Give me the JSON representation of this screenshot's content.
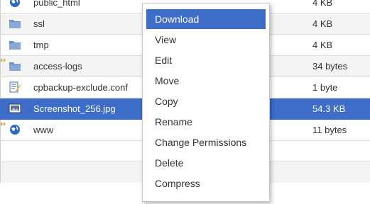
{
  "files": [
    {
      "name": "public_html",
      "size": "4 KB",
      "icon": "globe-folder-icon"
    },
    {
      "name": "ssl",
      "size": "4 KB",
      "icon": "folder-icon"
    },
    {
      "name": "tmp",
      "size": "4 KB",
      "icon": "folder-icon"
    },
    {
      "name": "access-logs",
      "size": "34 bytes",
      "icon": "folder-link-icon"
    },
    {
      "name": "cpbackup-exclude.conf",
      "size": "1 byte",
      "icon": "text-file-icon"
    },
    {
      "name": "Screenshot_256.jpg",
      "size": "54.3 KB",
      "icon": "image-file-icon"
    },
    {
      "name": "www",
      "size": "11 bytes",
      "icon": "globe-link-icon"
    }
  ],
  "context_menu": {
    "items": [
      "Download",
      "View",
      "Edit",
      "Move",
      "Copy",
      "Rename",
      "Change Permissions",
      "Delete",
      "Compress"
    ],
    "active_item": "Download"
  },
  "colors": {
    "selection": "#3d6dc9",
    "folder": "#6f93c6",
    "row_alt": "#f4f4f4"
  }
}
